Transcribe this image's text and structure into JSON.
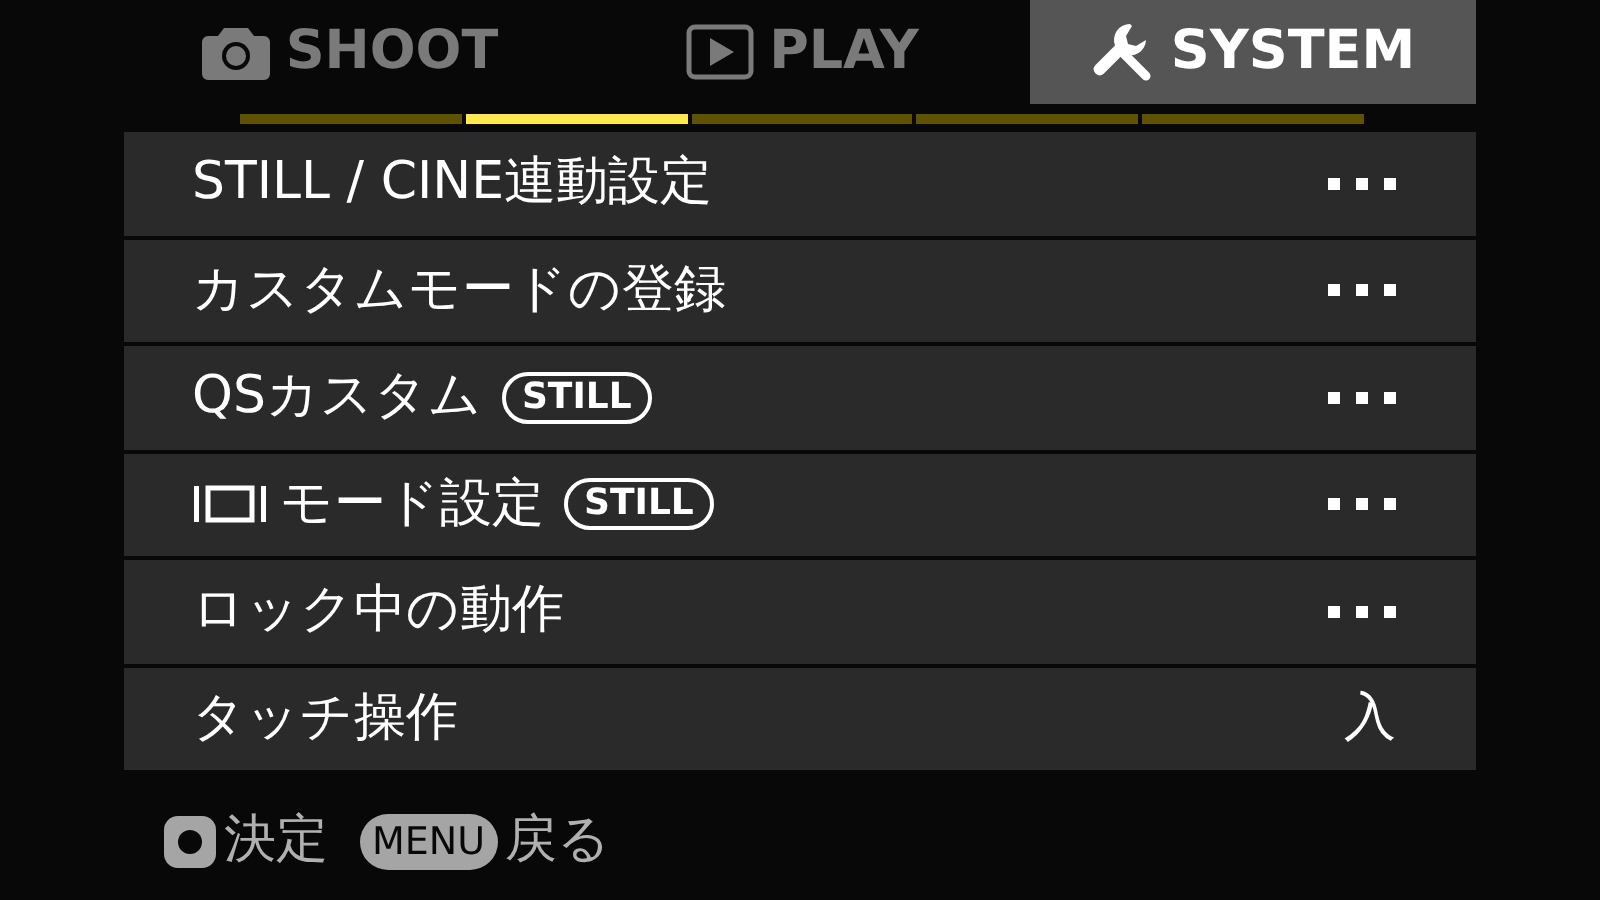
{
  "tabs": [
    {
      "label": "SHOOT",
      "selected": false
    },
    {
      "label": "PLAY",
      "selected": false
    },
    {
      "label": "SYSTEM",
      "selected": true
    }
  ],
  "pages": [
    {
      "selected": false
    },
    {
      "selected": true
    },
    {
      "selected": false
    },
    {
      "selected": false
    },
    {
      "selected": false
    }
  ],
  "rows": [
    {
      "label": "STILL / CINE連動設定",
      "kind": "submenu"
    },
    {
      "label": "カスタムモードの登録",
      "kind": "submenu"
    },
    {
      "label": "QSカスタム",
      "badge": "STILL",
      "kind": "submenu"
    },
    {
      "label": "モード設定",
      "badge": "STILL",
      "kind": "icon_submenu"
    },
    {
      "label": "ロック中の動作",
      "kind": "submenu"
    },
    {
      "label": "タッチ操作",
      "kind": "value",
      "value": "入"
    }
  ],
  "footer": [
    {
      "kind": "button",
      "label": "決定"
    },
    {
      "kind": "key",
      "key": "MENU",
      "label": "戻る"
    }
  ]
}
